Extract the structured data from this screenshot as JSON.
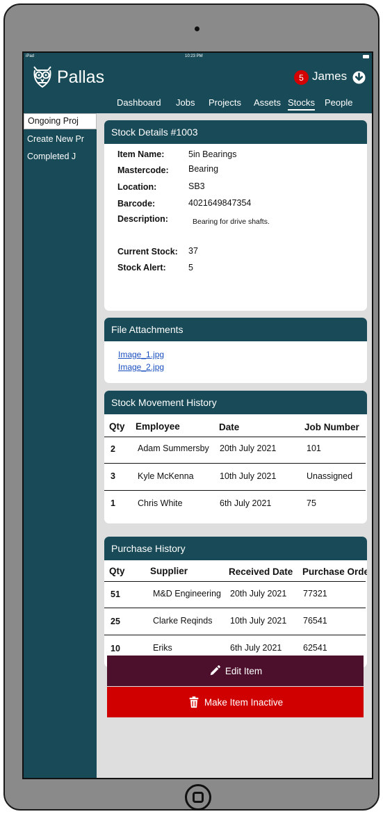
{
  "status_bar": {
    "device": "iPad",
    "time": "10:23 PM"
  },
  "app": {
    "name": "Pallas",
    "notifications": "5",
    "user": "James"
  },
  "nav": [
    {
      "label": "Dashboard",
      "active": false
    },
    {
      "label": "Jobs",
      "active": false
    },
    {
      "label": "Projects",
      "active": false
    },
    {
      "label": "Assets",
      "active": false
    },
    {
      "label": "Stocks",
      "active": true
    },
    {
      "label": "People",
      "active": false
    }
  ],
  "sidebar": [
    {
      "label": "Ongoing Proj",
      "active": true
    },
    {
      "label": "Create New Pr",
      "active": false
    },
    {
      "label": "Completed J",
      "active": false
    }
  ],
  "stock_details": {
    "title": "Stock Details #1003",
    "item_name_label": "Item Name:",
    "item_name": "5in Bearings",
    "mastercode_label": "Mastercode:",
    "mastercode": "Bearing",
    "location_label": "Location:",
    "location": "SB3",
    "barcode_label": "Barcode:",
    "barcode": "4021649847354",
    "description_label": "Description:",
    "description": "Bearing for drive shafts.",
    "current_stock_label": "Current Stock:",
    "current_stock": "37",
    "stock_alert_label": "Stock Alert:",
    "stock_alert": "5"
  },
  "attachments": {
    "title": "File Attachments",
    "files": [
      "Image_1.jpg",
      "Image_2.jpg"
    ]
  },
  "movement": {
    "title": "Stock Movement History",
    "headers": [
      "Qty",
      "Employee",
      "Date",
      "Job Number"
    ],
    "rows": [
      [
        "2",
        "Adam Summersby",
        "20th July 2021",
        "101"
      ],
      [
        "3",
        "Kyle McKenna",
        "10th July 2021",
        "Unassigned"
      ],
      [
        "1",
        "Chris White",
        "6th July 2021",
        "75"
      ]
    ]
  },
  "purchase": {
    "title": "Purchase History",
    "headers": [
      "Qty",
      "Supplier",
      "Received Date",
      "Purchase Order"
    ],
    "rows": [
      [
        "51",
        "M&D Engineering",
        "20th July 2021",
        "77321"
      ],
      [
        "25",
        "Clarke Reqinds",
        "10th July 2021",
        "76541"
      ],
      [
        "10",
        "Eriks",
        "6th July 2021",
        "62541"
      ]
    ]
  },
  "actions": {
    "edit": "Edit Item",
    "inactive": "Make Item Inactive"
  },
  "colors": {
    "primary": "#184a57",
    "edit_button": "#4d102c",
    "danger_button": "#d10000",
    "badge": "#d40000",
    "link": "#1a4fbf"
  }
}
